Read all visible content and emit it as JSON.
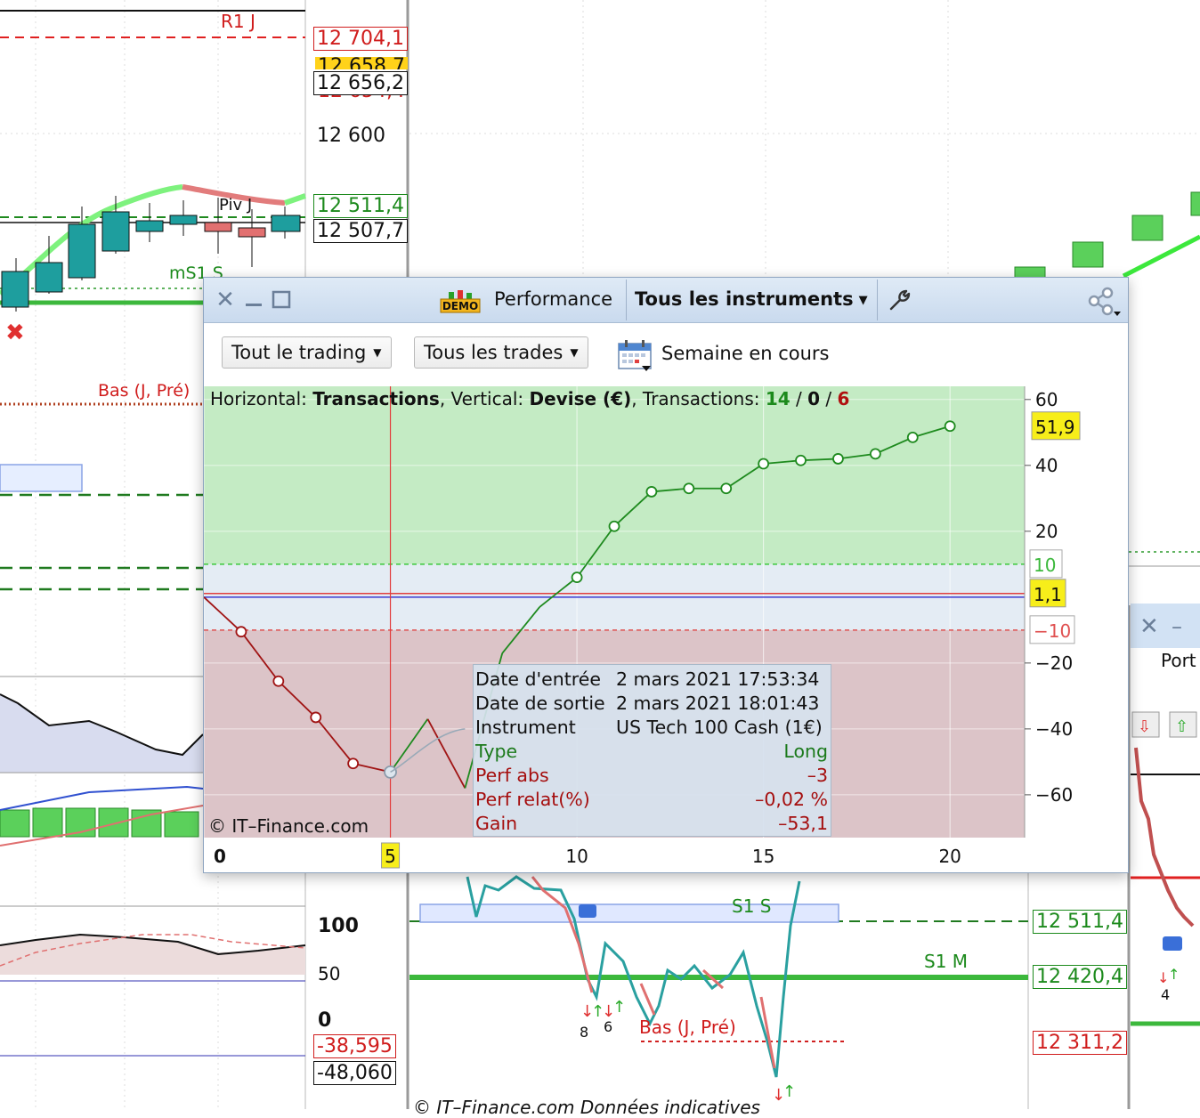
{
  "background": {
    "left_chart": {
      "price_labels": [
        {
          "text": "12 704,1",
          "color": "#d01c1c"
        },
        {
          "text": "12 658,7",
          "color": "#111111"
        },
        {
          "text": "12 656,2",
          "color": "#111111"
        },
        {
          "text": "12 654,4",
          "color": "#d01c1c"
        },
        {
          "text": "12 600",
          "color": "#111111"
        },
        {
          "text": "12 511,4",
          "color": "#1c8a1c"
        },
        {
          "text": "12 507,7",
          "color": "#111111"
        }
      ],
      "level_labels": [
        {
          "text": "R1 J",
          "color": "#d01c1c"
        },
        {
          "text": "Piv J",
          "color": "#111111"
        },
        {
          "text": "mS1 S",
          "color": "#1c8a1c"
        },
        {
          "text": "Bas (J, Pré)",
          "color": "#d01c1c"
        }
      ],
      "oscillator_labels": [
        "100",
        "50",
        "0",
        "-38,595",
        "-48,060"
      ]
    },
    "mid_chart": {
      "price_labels": [
        {
          "text": "12 511,4",
          "color": "#1c8a1c"
        },
        {
          "text": "12 420,4",
          "color": "#1c8a1c"
        },
        {
          "text": "12 311,2",
          "color": "#d01c1c"
        }
      ],
      "level_labels": [
        {
          "text": "S1 S",
          "color": "#1c8a1c"
        },
        {
          "text": "S1 M",
          "color": "#1c8a1c"
        },
        {
          "text": "Bas (J, Pré)",
          "color": "#d01c1c"
        }
      ],
      "trade_counts": [
        "8",
        "6"
      ],
      "footer": "© IT–Finance.com  Données indicatives"
    },
    "right_panel": {
      "title": "Port",
      "trade_count": "4"
    }
  },
  "window": {
    "title": "Performance",
    "demo_badge": "DEMO",
    "instrument_selector": "Tous les instruments",
    "filter_trading": "Tout le trading",
    "filter_trades": "Tous les trades",
    "period": "Semaine en cours",
    "info": {
      "horizontal_prefix": "Horizontal: ",
      "horizontal": "Transactions",
      "vertical_prefix": ", Vertical: ",
      "vertical": "Devise (€)",
      "transactions_prefix": ", Transactions: ",
      "wins": "14",
      "sep1": " / ",
      "neutral": "0",
      "sep2": " / ",
      "losses": "6"
    },
    "copyright": "© IT–Finance.com",
    "tooltip": {
      "entry_label": "Date d'entrée",
      "entry_value": "2 mars 2021 17:53:34",
      "exit_label": "Date de sortie",
      "exit_value": "2 mars 2021 18:01:43",
      "instrument_label": "Instrument",
      "instrument_value": "US Tech 100 Cash (1€)",
      "type_label": "Type",
      "type_value": "Long",
      "perf_abs_label": "Perf abs",
      "perf_abs_value": "–3",
      "perf_rel_label": "Perf relat(%)",
      "perf_rel_value": "–0,02 %",
      "gain_label": "Gain",
      "gain_value": "–53,1"
    }
  },
  "chart_data": {
    "type": "line",
    "xlabel": "",
    "ylabel": "",
    "xlim": [
      0,
      22
    ],
    "ylim": [
      -73,
      64
    ],
    "x_ticks": [
      0,
      5,
      10,
      15,
      20
    ],
    "y_ticks": [
      60,
      40,
      20,
      -20,
      -40,
      -60
    ],
    "bands": {
      "upper": 10,
      "lower": -10
    },
    "badges": {
      "last": "51,9",
      "upper": "10",
      "zero": "1,1",
      "lower": "-10",
      "cursor_x": "5"
    },
    "cursor_x": 5,
    "current_level": 1.1,
    "series": [
      {
        "x": [
          0,
          1,
          2,
          3,
          4,
          5,
          6,
          7,
          8,
          9,
          10,
          11,
          12,
          13,
          14,
          15,
          16,
          17,
          18,
          19,
          20
        ],
        "values": [
          0,
          -10.5,
          -25.5,
          -36.5,
          -50.5,
          -53.1,
          -37,
          -58,
          -17,
          -3,
          6,
          21.5,
          32,
          33,
          33,
          40.5,
          41.5,
          42,
          43.5,
          48.5,
          51.9
        ]
      }
    ],
    "colors": {
      "positive": "#1e8a1e",
      "negative": "#a01414",
      "cursor": "#e23c3c",
      "zero_line": "#3b3bd0"
    }
  }
}
